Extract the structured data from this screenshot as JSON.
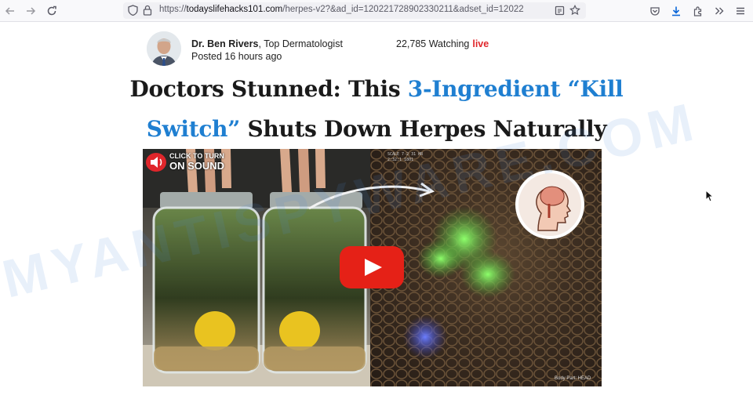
{
  "browser": {
    "url_prefix": "https://",
    "url_host": "todayslifehacks101.com",
    "url_path": "/herpes-v2?&ad_id=120221728902330211&adset_id=12022"
  },
  "icons": {
    "back": "back-arrow-icon",
    "forward": "forward-arrow-icon",
    "reload": "reload-icon",
    "shield": "tracking-shield-icon",
    "lock": "lock-icon",
    "reader": "reader-view-icon",
    "bookmark": "star-bookmark-icon",
    "pocket": "pocket-icon",
    "downloads": "download-icon",
    "extensions": "extensions-puzzle-icon",
    "overflow": "chevron-double-right-icon",
    "menu": "hamburger-menu-icon",
    "sound": "speaker-icon",
    "play": "play-icon",
    "brain": "brain-head-icon"
  },
  "article": {
    "author_name": "Dr. Ben Rivers",
    "author_title": ", Top Dermatologist",
    "posted": "Posted 16 hours ago",
    "watching": "22,785 Watching",
    "live": "live",
    "headline_part1": "Doctors Stunned: This ",
    "headline_highlight1": "3-Ingredient “Kill Switch”",
    "headline_part2": " Shuts Down Herpes Naturally"
  },
  "video": {
    "sound_line1": "CLICK TO TURN",
    "sound_line2": "ON SOUND",
    "corner_caption": "Body Part: HEAD",
    "micro_text_line1": "SCALE 7-2 31 HR",
    "micro_text_line2": "2:32:1 1801"
  },
  "watermark_text": "MYANTISPYWARE.COM",
  "colors": {
    "accent_blue": "#1f7fd1",
    "live_red": "#e0262b",
    "play_red": "#e52117"
  }
}
